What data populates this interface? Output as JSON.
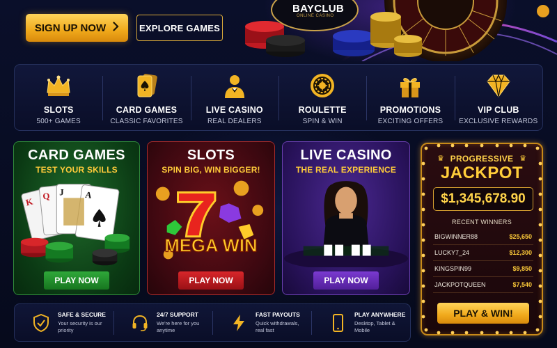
{
  "header": {
    "signup_label": "SIGN UP NOW",
    "explore_label": "EXPLORE GAMES",
    "logo_text": "BAYCLUB",
    "logo_sub": "ONLINE CASINO"
  },
  "categories": [
    {
      "title": "SLOTS",
      "sub": "500+ GAMES",
      "icon": "crown-icon"
    },
    {
      "title": "CARD GAMES",
      "sub": "CLASSIC FAVORITES",
      "icon": "spade-card-icon"
    },
    {
      "title": "LIVE CASINO",
      "sub": "REAL DEALERS",
      "icon": "dealer-icon"
    },
    {
      "title": "ROULETTE",
      "sub": "SPIN & WIN",
      "icon": "roulette-icon"
    },
    {
      "title": "PROMOTIONS",
      "sub": "EXCITING OFFERS",
      "icon": "gift-icon"
    },
    {
      "title": "VIP CLUB",
      "sub": "EXCLUSIVE REWARDS",
      "icon": "diamond-icon"
    }
  ],
  "games": [
    {
      "title": "CARD GAMES",
      "sub": "TEST YOUR SKILLS",
      "button": "PLAY NOW"
    },
    {
      "title": "SLOTS",
      "sub": "SPIN BIG, WIN BIGGER!",
      "button": "PLAY NOW",
      "art_text": "MEGA WIN"
    },
    {
      "title": "LIVE CASINO",
      "sub": "THE REAL EXPERIENCE",
      "button": "PLAY NOW"
    }
  ],
  "jackpot": {
    "progressive": "PROGRESSIVE",
    "title": "JACKPOT",
    "amount": "$1,345,678.90",
    "recent_label": "RECENT WINNERS",
    "winners": [
      {
        "name": "BIGWINNER88",
        "amount": "$25,650"
      },
      {
        "name": "LUCKY7_24",
        "amount": "$12,300"
      },
      {
        "name": "KINGSPIN99",
        "amount": "$9,850"
      },
      {
        "name": "JACKPOTQUEEN",
        "amount": "$7,540"
      }
    ],
    "button": "PLAY & WIN!"
  },
  "features": [
    {
      "title": "SAFE & SECURE",
      "desc": "Your security is our priority",
      "icon": "shield-icon"
    },
    {
      "title": "24/7 SUPPORT",
      "desc": "We're here for you anytime",
      "icon": "headset-icon"
    },
    {
      "title": "FAST PAYOUTS",
      "desc": "Quick withdrawals, real fast",
      "icon": "lightning-icon"
    },
    {
      "title": "PLAY ANYWHERE",
      "desc": "Desktop, Tablet & Mobile",
      "icon": "mobile-icon"
    }
  ],
  "colors": {
    "gold": "#f0a91b",
    "green": "#2fa83a",
    "red": "#d8262a",
    "purple": "#7a3ad0",
    "navy": "#070b1f"
  }
}
